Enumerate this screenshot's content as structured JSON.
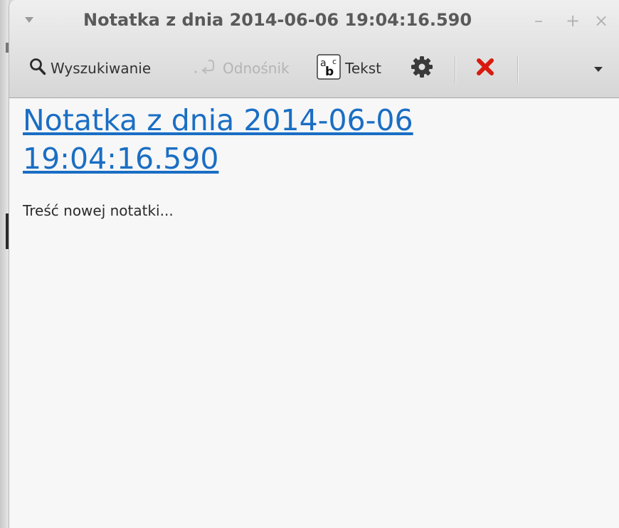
{
  "window": {
    "title": "Notatka z dnia 2014-06-06 19:04:16.590",
    "controls": {
      "minimize": "–",
      "maximize": "+",
      "close": "×"
    }
  },
  "toolbar": {
    "search_label": "Wyszukiwanie",
    "link_label": "Odnośnik",
    "text_label": "Tekst",
    "icons": {
      "search": "search-icon",
      "link": "link-icon",
      "text": "text-format-icon",
      "settings": "gear-icon",
      "delete": "delete-icon",
      "more": "chevron-down-icon"
    },
    "colors": {
      "delete": "#d81b0f",
      "disabled": "#b4b4b4"
    }
  },
  "note": {
    "title": "Notatka z dnia 2014-06-06 19:04:16.590",
    "body": "Treść nowej notatki...",
    "link_color": "#1a6ec4"
  }
}
